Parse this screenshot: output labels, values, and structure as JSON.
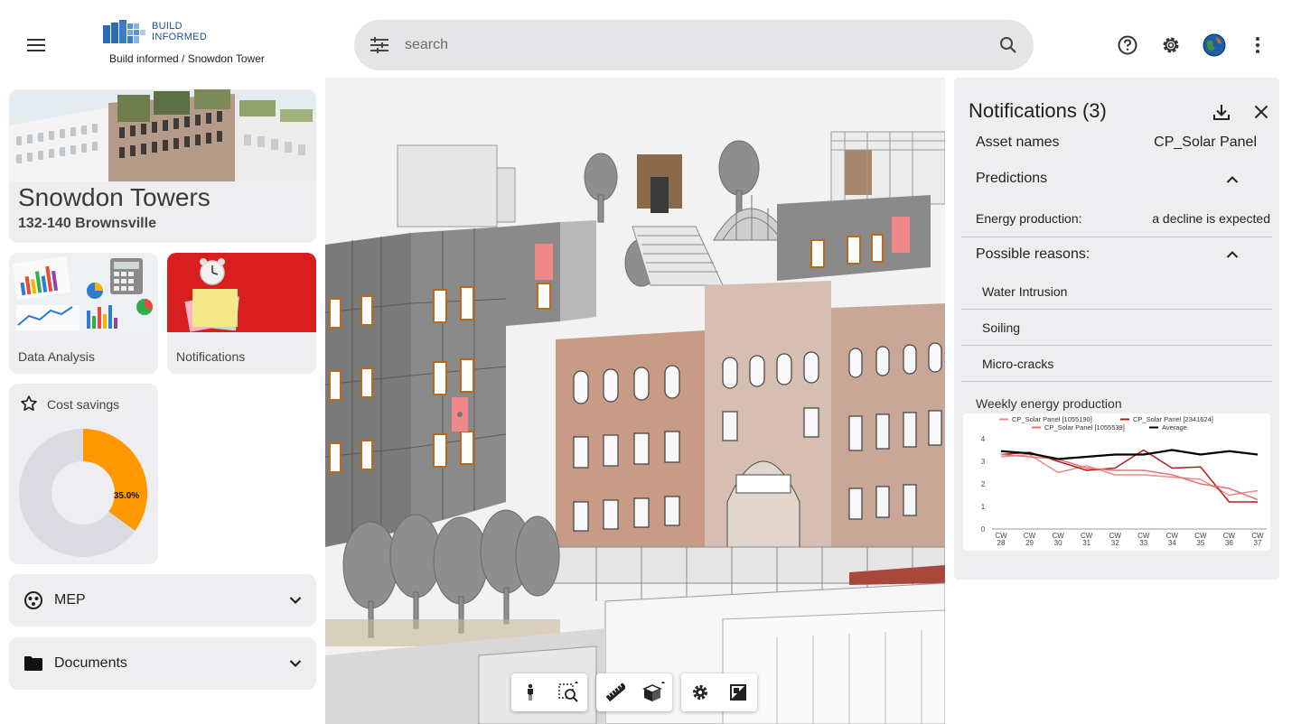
{
  "header": {
    "logo_line1": "BUILD",
    "logo_line2": "INFORMED",
    "breadcrumb": "Build informed / Snowdon Tower",
    "search_placeholder": "search",
    "icons": [
      "menu-icon",
      "tune-icon",
      "search-icon",
      "help-icon",
      "gear-icon",
      "avatar",
      "more-vert-icon"
    ]
  },
  "project": {
    "title": "Snowdon Towers",
    "address": "132-140 Brownsville"
  },
  "tiles": {
    "data_analysis": "Data Analysis",
    "notifications": "Notifications"
  },
  "cost_savings": {
    "label": "Cost savings",
    "percent_label": "35.0%",
    "value": 0.35,
    "colors": {
      "fill": "#ff9800",
      "rest": "#dadae0"
    }
  },
  "accordions": {
    "mep": "MEP",
    "documents": "Documents"
  },
  "viewer_toolbar": [
    "walk-icon",
    "zoom-region-icon",
    "measure-icon",
    "section-box-icon",
    "settings-icon",
    "fullscreen-toggle-icon"
  ],
  "notifications": {
    "title": "Notifications (3)",
    "asset_label": "Asset names",
    "asset_value": "CP_Solar Panel",
    "predictions_label": "Predictions",
    "energy_label": "Energy production:",
    "energy_value": "a decline is expected",
    "reasons_label": "Possible reasons:",
    "reasons": [
      "Water Intrusion",
      "Soiling",
      "Micro-cracks"
    ],
    "chart_title": "Weekly energy production"
  },
  "chart_data": {
    "type": "line",
    "title": "Weekly energy production",
    "categories": [
      "CW 28",
      "CW 29",
      "CW 30",
      "CW 31",
      "CW 32",
      "CW 33",
      "CW 34",
      "CW 35",
      "CW 36",
      "CW 37"
    ],
    "ylim": [
      0,
      4
    ],
    "yticks": [
      0,
      1,
      2,
      3,
      4
    ],
    "legend_position": "top",
    "series": [
      {
        "name": "CP_Solar Panel [1055190]",
        "color": "#f08a8a",
        "values": [
          3.2,
          3.3,
          2.5,
          2.8,
          2.4,
          2.4,
          2.3,
          2.2,
          1.5,
          1.7
        ]
      },
      {
        "name": "CP_Solar Panel [2341624]",
        "color": "#b71c1c",
        "values": [
          3.3,
          3.4,
          3.0,
          2.6,
          2.7,
          3.5,
          2.7,
          2.75,
          1.2,
          1.2
        ]
      },
      {
        "name": "CP_Solar Panel [1055539]",
        "color": "#e57373",
        "values": [
          3.3,
          3.2,
          3.1,
          2.7,
          2.6,
          2.6,
          2.4,
          2.0,
          1.8,
          1.3
        ]
      },
      {
        "name": "Average",
        "color": "#000000",
        "values": [
          3.45,
          3.35,
          3.1,
          3.2,
          3.3,
          3.3,
          3.5,
          3.3,
          3.45,
          3.3
        ]
      }
    ]
  }
}
